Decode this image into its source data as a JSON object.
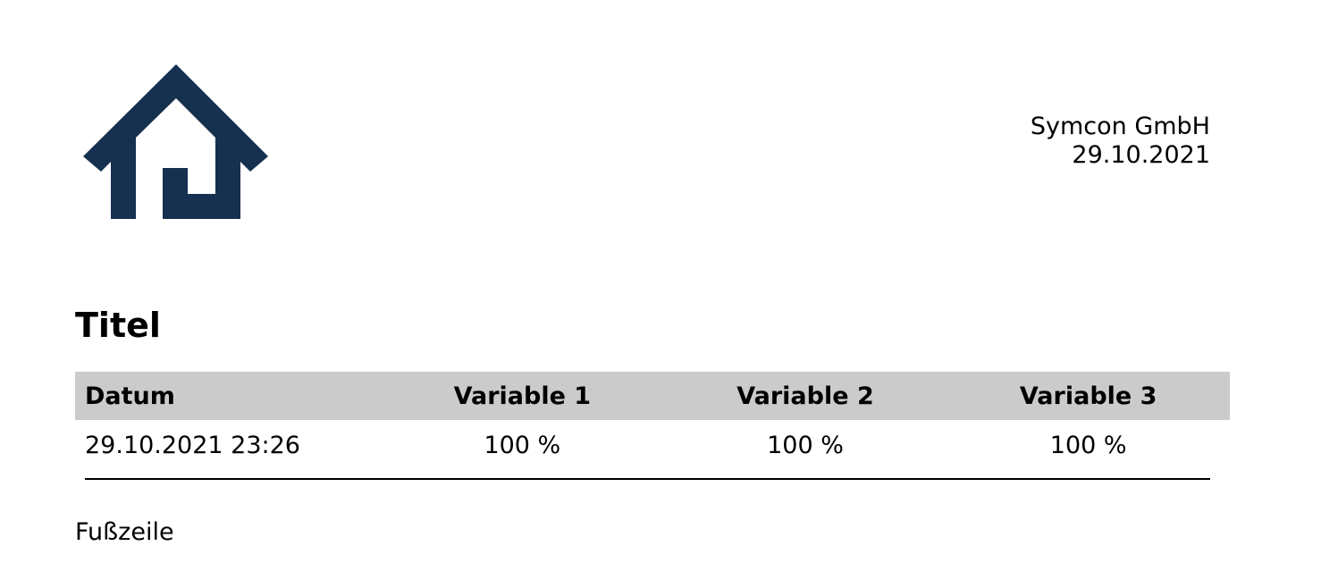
{
  "header": {
    "logo_icon": "house-logo-icon",
    "logo_color": "#16304f",
    "company": "Symcon GmbH",
    "date": "29.10.2021"
  },
  "title": "Titel",
  "table": {
    "header_bg": "#cbcbcb",
    "columns": [
      "Datum",
      "Variable 1",
      "Variable 2",
      "Variable 3"
    ],
    "rows": [
      [
        "29.10.2021 23:26",
        "100 %",
        "100 %",
        "100 %"
      ]
    ]
  },
  "footer": "Fußzeile"
}
